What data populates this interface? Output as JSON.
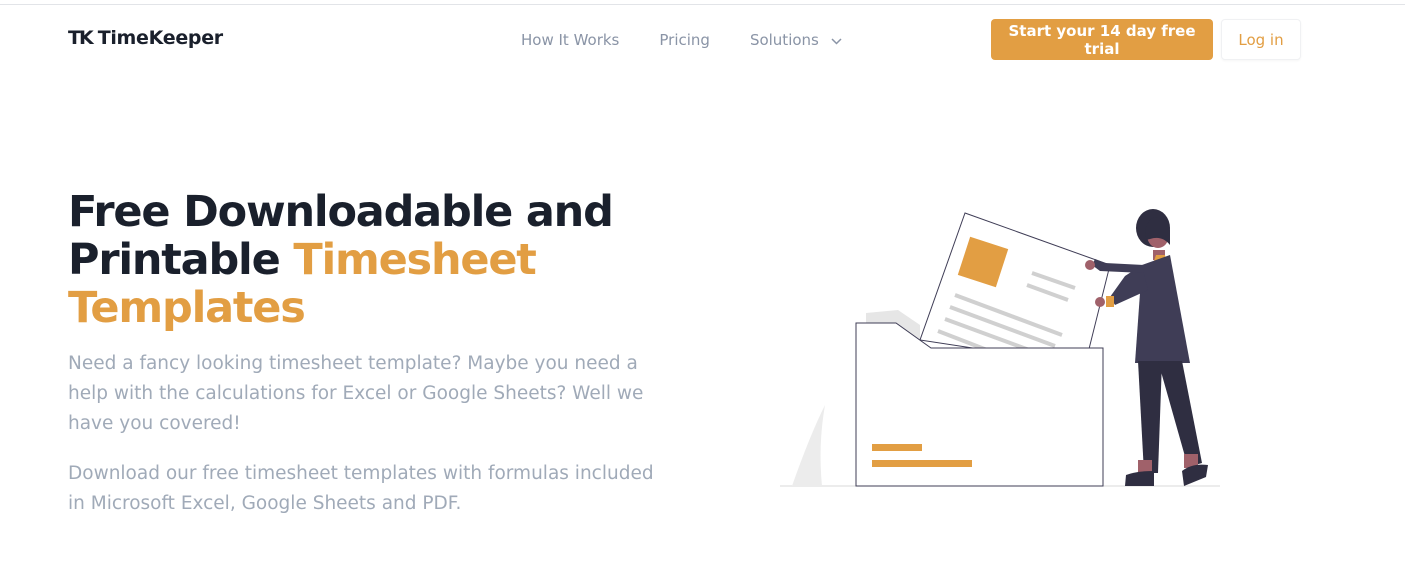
{
  "brand": {
    "mark": "TK",
    "name": "TimeKeeper"
  },
  "nav": {
    "items": [
      {
        "label": "How It Works"
      },
      {
        "label": "Pricing"
      },
      {
        "label": "Solutions",
        "icon": "chevron-down-icon"
      }
    ]
  },
  "actions": {
    "trial_label": "Start your 14 day free trial",
    "login_label": "Log in"
  },
  "hero": {
    "title_part1": "Free Downloadable and Printable ",
    "title_accent": "Timesheet Templates",
    "paragraph1": "Need a fancy looking timesheet template? Maybe you need a help with the calculations for Excel or Google Sheets? Well we have you covered!",
    "paragraph2": "Download our free timesheet templates with formulas included in Microsoft Excel, Google Sheets and PDF."
  },
  "colors": {
    "accent": "#e29e43",
    "heading": "#1a202c",
    "muted": "#a0aab8",
    "nav": "#8a94a6"
  }
}
